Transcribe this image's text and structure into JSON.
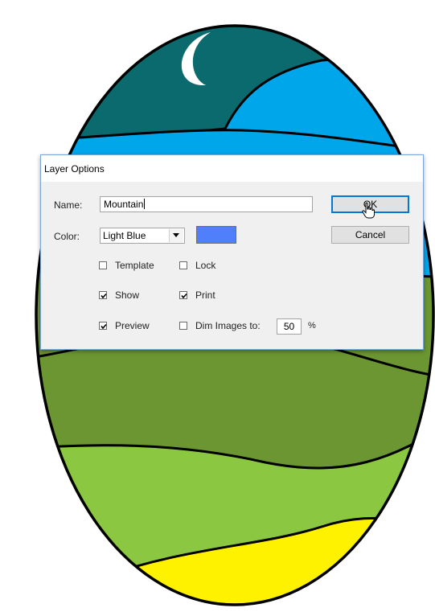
{
  "colors": {
    "night_sky": "#0b6a6d",
    "sky_blue": "#00a6ea",
    "grass_dark": "#6b9632",
    "grass_light": "#8bc740",
    "sun_yellow": "#fff200",
    "moon": "#ffffff",
    "layer_color_swatch": "#4f7ffb"
  },
  "dialog": {
    "title": "Layer Options",
    "name_label": "Name:",
    "name_value": "Mountain",
    "color_label": "Color:",
    "color_value": "Light Blue",
    "ok_label": "OK",
    "cancel_label": "Cancel",
    "options": {
      "template": {
        "label": "Template",
        "checked": false
      },
      "lock": {
        "label": "Lock",
        "checked": false
      },
      "show": {
        "label": "Show",
        "checked": true
      },
      "print": {
        "label": "Print",
        "checked": true
      },
      "preview": {
        "label": "Preview",
        "checked": true
      },
      "dim_images": {
        "label": "Dim Images to:",
        "checked": false
      }
    },
    "dim_value": "50",
    "dim_unit": "%"
  }
}
